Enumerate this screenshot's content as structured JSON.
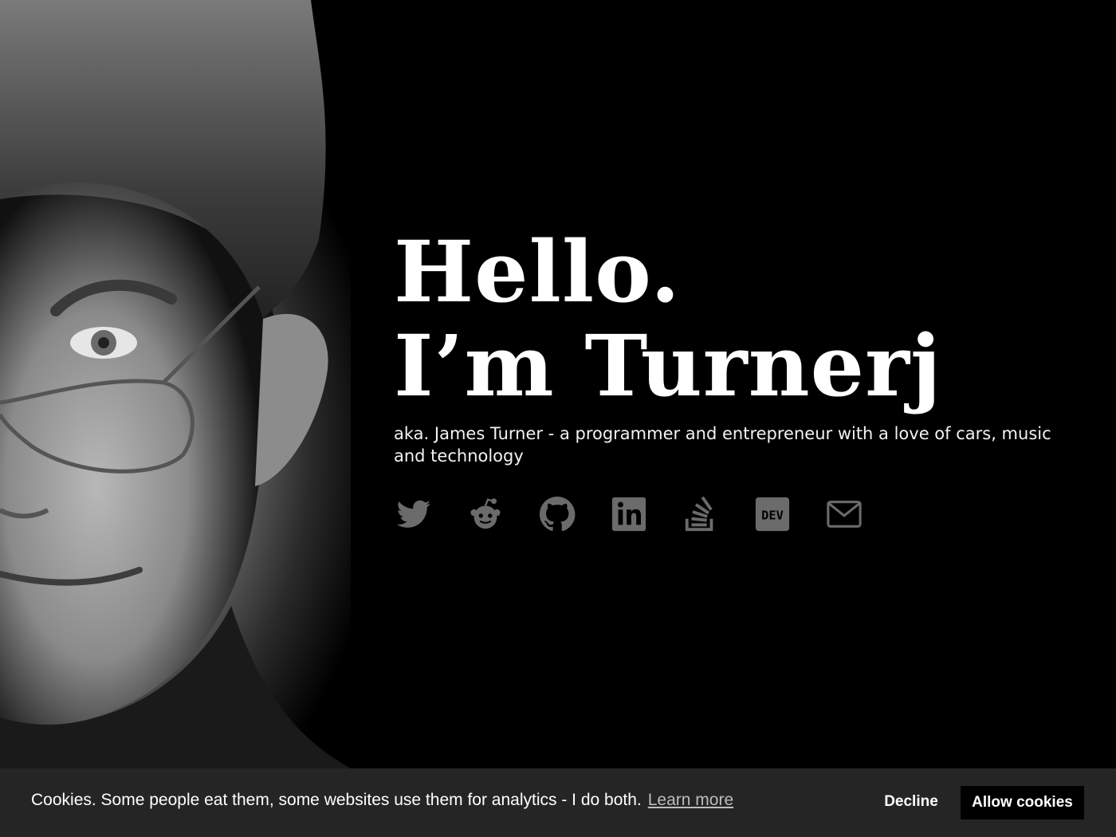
{
  "hero": {
    "headline_line1": "Hello.",
    "headline_line2": "I’m Turnerj",
    "tagline": "aka. James Turner - a programmer and entrepreneur with a love of cars, music and technology"
  },
  "social": [
    {
      "icon": "twitter-icon"
    },
    {
      "icon": "reddit-icon"
    },
    {
      "icon": "github-icon"
    },
    {
      "icon": "linkedin-icon"
    },
    {
      "icon": "stackoverflow-icon"
    },
    {
      "icon": "dev-icon",
      "text": "DEV"
    },
    {
      "icon": "email-icon"
    }
  ],
  "cookie": {
    "message": "Cookies. Some people eat them, some websites use them for analytics - I do both.",
    "learn_more": "Learn more",
    "decline": "Decline",
    "allow": "Allow cookies"
  },
  "colors": {
    "background": "#000000",
    "cookie_bar": "#252525",
    "icon": "#6b6b6b",
    "text": "#ffffff"
  }
}
